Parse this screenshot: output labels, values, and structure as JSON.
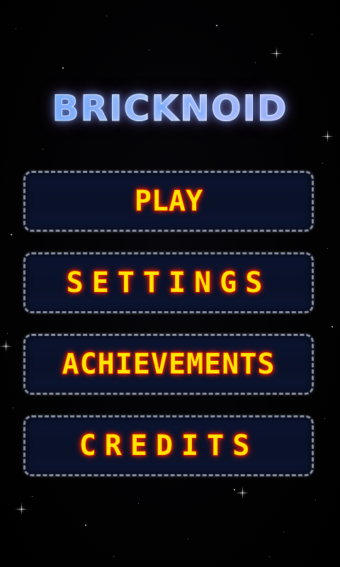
{
  "logo": {
    "text": "BRICKNOID"
  },
  "menu": {
    "play": "PLAY",
    "settings": "SETTINGS",
    "achievements": "ACHIEVEMENTS",
    "credits": "CREDITS"
  },
  "colors": {
    "background": "#000000",
    "button_fill": "#0a1129",
    "button_border": "#8a8f9a",
    "label_text": "#ffe600",
    "label_glow": "#d80000",
    "logo_left": "#5fb8ff",
    "logo_right": "#ffe6ff"
  }
}
